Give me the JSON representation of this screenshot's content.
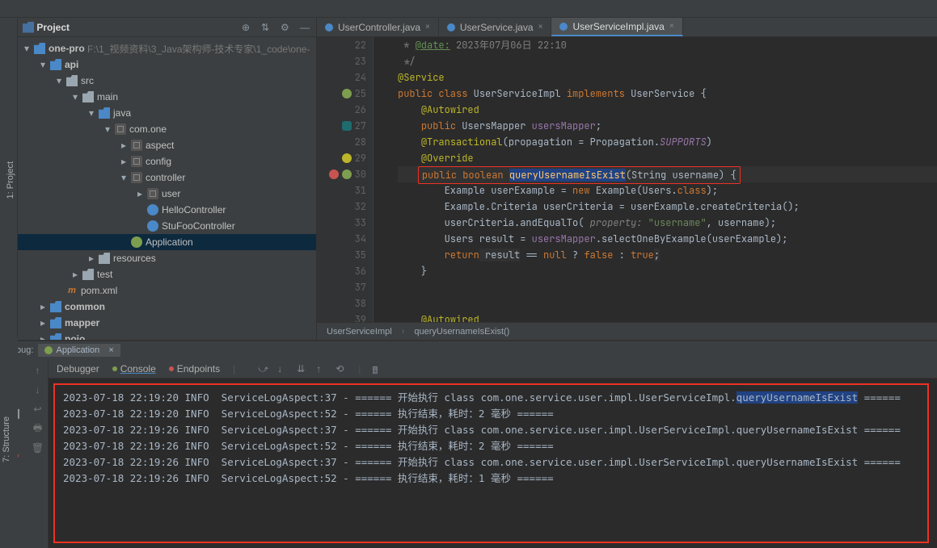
{
  "project": {
    "title": "Project",
    "root": "one-pro",
    "rootPath": "F:\\1_视频资料\\3_Java架构师-技术专家\\1_code\\one-",
    "tree": {
      "api": "api",
      "src": "src",
      "main": "main",
      "java": "java",
      "pkg": "com.one",
      "aspect": "aspect",
      "config": "config",
      "controller": "controller",
      "user": "user",
      "hello": "HelloController",
      "stu": "StuFooController",
      "app": "Application",
      "resources": "resources",
      "test": "test",
      "pom": "pom.xml",
      "common": "common",
      "mapper": "mapper",
      "pojo": "pojo"
    }
  },
  "sideTabs": {
    "project": "1: Project",
    "structure": "7: Structure"
  },
  "editorTabs": [
    {
      "name": "UserController.java"
    },
    {
      "name": "UserService.java"
    },
    {
      "name": "UserServiceImpl.java"
    }
  ],
  "code": {
    "start": 22,
    "comment_date": "@date:",
    "comment_date_val": "2023年07月06日 22:10",
    "service": "@Service",
    "cls1": "public",
    "cls2": "class",
    "cls3": "UserServiceImpl",
    "cls4": "implements",
    "cls5": "UserService {",
    "autowired": "@Autowired",
    "fld1": "public",
    "fld2": "UsersMapper",
    "fld3": "usersMapper",
    "trans": "@Transactional",
    "trans_args1": "(",
    "trans_prop": "propagation",
    "trans_args2": " = Propagation.",
    "trans_sup": "SUPPORTS",
    "trans_args3": ")",
    "override": "@Override",
    "sig1": "public boolean",
    "sig2": "queryUsernameIsExist",
    "sig3": "(String username) {",
    "l1a": "Example userExample = ",
    "l1b": "new",
    "l1c": " Example(Users.",
    "l1d": "class",
    "l1e": ");",
    "l2": "Example.Criteria userCriteria = userExample.createCriteria();",
    "l3a": "userCriteria.andEqualTo(",
    "l3b": " property:",
    "l3c": " \"username\"",
    "l3d": ", username);",
    "l4a": "Users result = ",
    "l4b": "usersMapper",
    "l4c": ".selectOneByExample(userExample);",
    "l5a": "return",
    "l5b": " result",
    "l5c": " == ",
    "l5d": "null",
    "l5e": " ? ",
    "l5f": "false",
    "l5g": " : ",
    "l5h": "true",
    "l5i": ";",
    "close": "}",
    "autowired2": "@Autowired"
  },
  "breadcrumb": {
    "a": "UserServiceImpl",
    "b": "queryUsernameIsExist()"
  },
  "debug": {
    "label": "Debug:",
    "app": "Application",
    "tabs": {
      "debugger": "Debugger",
      "console": "Console",
      "endpoints": "Endpoints"
    },
    "lines": [
      {
        "t": "2023-07-18 22:19:20 INFO  ServiceLogAspect:37 - ====== 开始执行 class com.one.service.user.impl.UserServiceImpl.",
        "h": "queryUsernameIsExist",
        "s": " ======"
      },
      {
        "t": "2023-07-18 22:19:20 INFO  ServiceLogAspect:52 - ====== 执行结束，耗时：2 毫秒 ======"
      },
      {
        "t": "2023-07-18 22:19:26 INFO  ServiceLogAspect:37 - ====== 开始执行 class com.one.service.user.impl.UserServiceImpl.queryUsernameIsExist ======"
      },
      {
        "t": "2023-07-18 22:19:26 INFO  ServiceLogAspect:52 - ====== 执行结束，耗时：2 毫秒 ======"
      },
      {
        "t": "2023-07-18 22:19:26 INFO  ServiceLogAspect:37 - ====== 开始执行 class com.one.service.user.impl.UserServiceImpl.queryUsernameIsExist ======"
      },
      {
        "t": "2023-07-18 22:19:26 INFO  ServiceLogAspect:52 - ====== 执行结束，耗时：1 毫秒 ======"
      }
    ]
  }
}
